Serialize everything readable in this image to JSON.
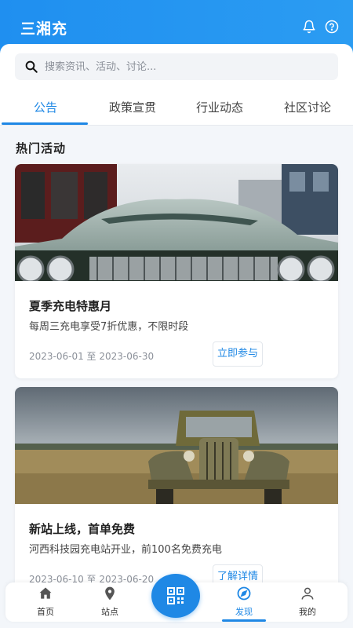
{
  "header": {
    "title": "三湘充",
    "bell_icon": "bell-icon",
    "help_icon": "help-circle-icon"
  },
  "search": {
    "placeholder": "搜索资讯、活动、讨论...",
    "value": ""
  },
  "tabs": [
    {
      "label": "公告",
      "active": true
    },
    {
      "label": "政策宣贯",
      "active": false
    },
    {
      "label": "行业动态",
      "active": false
    },
    {
      "label": "社区讨论",
      "active": false
    }
  ],
  "section": {
    "title": "热门活动"
  },
  "cards": [
    {
      "title": "夏季充电特惠月",
      "description": "每周三充电享受7折优惠，不限时段",
      "date": "2023-06-01 至 2023-06-30",
      "button": "立即参与"
    },
    {
      "title": "新站上线，首单免费",
      "description": "河西科技园充电站开业，前100名免费充电",
      "date": "2023-06-10 至 2023-06-20",
      "button": "了解详情"
    }
  ],
  "bottom_nav": {
    "items": [
      {
        "label": "首页",
        "icon": "home-icon"
      },
      {
        "label": "站点",
        "icon": "location-pin-icon"
      },
      {
        "label": "发现",
        "icon": "compass-icon",
        "active": true
      },
      {
        "label": "我的",
        "icon": "user-icon"
      }
    ],
    "center_icon": "qr-code-icon"
  },
  "colors": {
    "accent": "#1f88e5",
    "header_gradient_start": "#1f8ff0",
    "header_gradient_end": "#2b9cf2",
    "background": "#f3f6fa"
  }
}
